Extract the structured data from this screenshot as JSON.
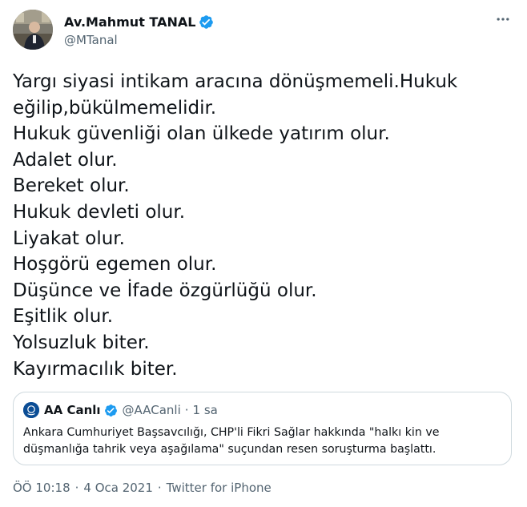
{
  "author": {
    "display_name": "Av.Mahmut TANAL",
    "handle": "@MTanal",
    "verified": true,
    "avatar": "avatar-photo"
  },
  "more_icon": "more-options-icon",
  "tweet_lines": [
    "Yargı siyasi intikam aracına dönüşmemeli.Hukuk",
    "eğilip,bükülmemelidir.",
    "Hukuk güvenliği olan ülkede yatırım olur.",
    "Adalet olur.",
    "Bereket olur.",
    "Hukuk devleti olur.",
    "Liyakat olur.",
    "Hoşgörü egemen olur.",
    "Düşünce ve İfade özgürlüğü olur.",
    "Eşitlik olur.",
    "Yolsuzluk biter.",
    "Kayırmacılık biter."
  ],
  "quoted_tweet": {
    "display_name": "AA Canlı",
    "handle": "@AACanli",
    "dot": "·",
    "time": "1 sa",
    "verified": true,
    "text_lines": [
      "Ankara Cumhuriyet Başsavcılığı, CHP'li Fikri Sağlar hakkında \"halkı kin ve",
      "düşmanlığa tahrik veya aşağılama\" suçundan resen soruşturma başlattı."
    ]
  },
  "meta": {
    "time": "ÖÖ 10:18",
    "sep1": "·",
    "date": "4 Oca 2021",
    "sep2": "·",
    "source": "Twitter for iPhone"
  },
  "colors": {
    "verified_blue": "#1d9bf0",
    "text": "#0f1419",
    "secondary": "#536471",
    "border": "#cfd9de",
    "aa_blue": "#0b4d95"
  }
}
